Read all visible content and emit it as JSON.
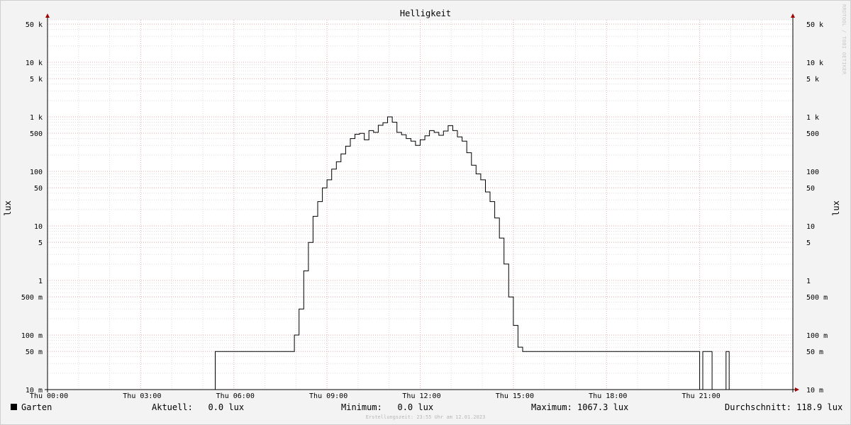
{
  "chart_data": {
    "type": "line",
    "title": "Helligkeit",
    "ylabel": "lux",
    "yscale": "log",
    "ylim": [
      0.01,
      80000
    ],
    "xlim": [
      0,
      24
    ],
    "x_tick_labels": [
      "Thu 00:00",
      "Thu 03:00",
      "Thu 06:00",
      "Thu 09:00",
      "Thu 12:00",
      "Thu 15:00",
      "Thu 18:00",
      "Thu 21:00"
    ],
    "x_tick_hours": [
      0,
      3,
      6,
      9,
      12,
      15,
      18,
      21
    ],
    "y_ticks": [
      {
        "value": 0.01,
        "label": "10 m"
      },
      {
        "value": 0.05,
        "label": "50 m"
      },
      {
        "value": 0.1,
        "label": "100 m"
      },
      {
        "value": 0.5,
        "label": "500 m"
      },
      {
        "value": 1,
        "label": "1"
      },
      {
        "value": 5,
        "label": "5"
      },
      {
        "value": 10,
        "label": "10"
      },
      {
        "value": 50,
        "label": "50"
      },
      {
        "value": 100,
        "label": "100"
      },
      {
        "value": 500,
        "label": "500"
      },
      {
        "value": 1000,
        "label": "1 k"
      },
      {
        "value": 5000,
        "label": "5 k"
      },
      {
        "value": 10000,
        "label": "10 k"
      },
      {
        "value": 50000,
        "label": "50 k"
      }
    ],
    "grid": true,
    "series": [
      {
        "name": "Garten",
        "color": "#000000",
        "x": [
          0,
          5.4,
          5.4,
          7.85,
          7.95,
          8.1,
          8.25,
          8.4,
          8.55,
          8.7,
          8.85,
          9.0,
          9.15,
          9.3,
          9.45,
          9.6,
          9.75,
          9.9,
          10.05,
          10.2,
          10.35,
          10.5,
          10.65,
          10.8,
          10.95,
          11.1,
          11.25,
          11.4,
          11.55,
          11.7,
          11.85,
          12.0,
          12.15,
          12.3,
          12.45,
          12.6,
          12.75,
          12.9,
          13.05,
          13.2,
          13.35,
          13.5,
          13.65,
          13.8,
          13.95,
          14.1,
          14.25,
          14.4,
          14.55,
          14.7,
          14.85,
          15.0,
          15.15,
          15.3,
          15.45,
          15.6,
          15.75,
          15.9,
          16.05,
          16.2,
          16.35,
          16.5,
          16.65,
          16.8,
          16.95,
          17.1,
          17.25,
          17.4,
          17.55,
          17.7,
          17.8,
          17.9,
          17.95,
          21.0,
          21.0,
          21.1,
          21.1,
          21.4,
          21.4,
          21.85,
          21.85,
          21.95,
          21.95,
          24
        ],
        "y": [
          0.01,
          0.01,
          0.05,
          0.05,
          0.1,
          0.3,
          1.5,
          5,
          15,
          28,
          50,
          70,
          110,
          150,
          210,
          290,
          400,
          480,
          500,
          380,
          560,
          520,
          700,
          780,
          1000,
          800,
          520,
          470,
          400,
          360,
          300,
          380,
          450,
          560,
          520,
          460,
          550,
          690,
          560,
          430,
          360,
          220,
          130,
          90,
          70,
          42,
          28,
          14,
          6,
          2,
          0.5,
          0.15,
          0.06,
          0.05,
          0.05,
          0.05,
          0.05,
          0.05,
          0.05,
          0.05,
          0.05,
          0.05,
          0.05,
          0.05,
          0.05,
          0.05,
          0.05,
          0.05,
          0.05,
          0.05,
          0.05,
          0.05,
          0.05,
          0.05,
          0.01,
          0.01,
          0.05,
          0.05,
          0.01,
          0.01,
          0.05,
          0.05,
          0.01,
          0.01
        ]
      }
    ]
  },
  "legend": {
    "series_name": "Garten",
    "current": "Aktuell:   0.0 lux",
    "minimum": "Minimum:   0.0 lux",
    "maximum": "Maximum: 1067.3 lux",
    "average": "Durchschnitt: 118.9 lux"
  },
  "watermark": "RRDTOOL / TOBI OETIKER",
  "footer": "Erstellungszeit: 23:55 Uhr am 12.01.2023"
}
